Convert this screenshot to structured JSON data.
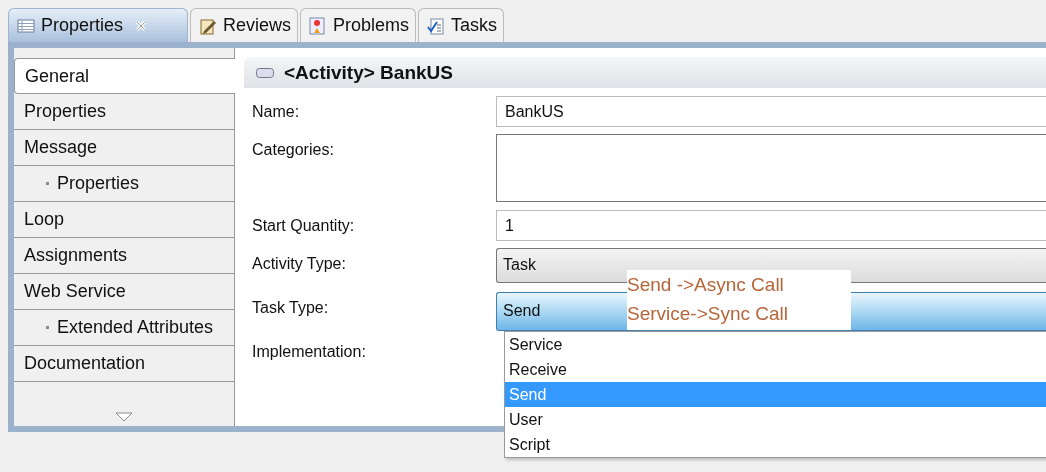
{
  "tabs": [
    {
      "label": "Properties",
      "selected": true,
      "closable": true
    },
    {
      "label": "Reviews",
      "selected": false,
      "closable": false
    },
    {
      "label": "Problems",
      "selected": false,
      "closable": false
    },
    {
      "label": "Tasks",
      "selected": false,
      "closable": false
    }
  ],
  "sidebar": {
    "items": [
      {
        "label": "General",
        "selected": true
      },
      {
        "label": "Properties",
        "selected": false
      },
      {
        "label": "Message",
        "selected": false,
        "children": [
          {
            "label": "Properties",
            "selected": false
          }
        ]
      },
      {
        "label": "Loop",
        "selected": false
      },
      {
        "label": "Assignments",
        "selected": false
      },
      {
        "label": "Web Service",
        "selected": false,
        "children": [
          {
            "label": "Extended Attributes",
            "selected": false
          }
        ]
      },
      {
        "label": "Documentation",
        "selected": false
      }
    ]
  },
  "header": {
    "title": "<Activity> BankUS"
  },
  "fields": [
    {
      "label": "Name:",
      "kind": "text",
      "value": "BankUS"
    },
    {
      "label": "Categories:",
      "kind": "textarea"
    },
    {
      "label": "Start Quantity:",
      "kind": "text",
      "value": "1"
    },
    {
      "label": "Activity Type:",
      "kind": "combo",
      "value": "Task",
      "focused": false
    },
    {
      "label": "Task Type:",
      "kind": "combo",
      "value": "Send",
      "focused": true
    },
    {
      "label": "Implementation:",
      "kind": "none"
    }
  ],
  "dropdown": {
    "options": [
      {
        "label": "Service",
        "selected": false
      },
      {
        "label": "Receive",
        "selected": false
      },
      {
        "label": "Send",
        "selected": true
      },
      {
        "label": "User",
        "selected": false
      },
      {
        "label": "Script",
        "selected": false
      }
    ]
  },
  "callout": {
    "lines": [
      "Send ->Async Call",
      "Service->Sync Call"
    ]
  }
}
